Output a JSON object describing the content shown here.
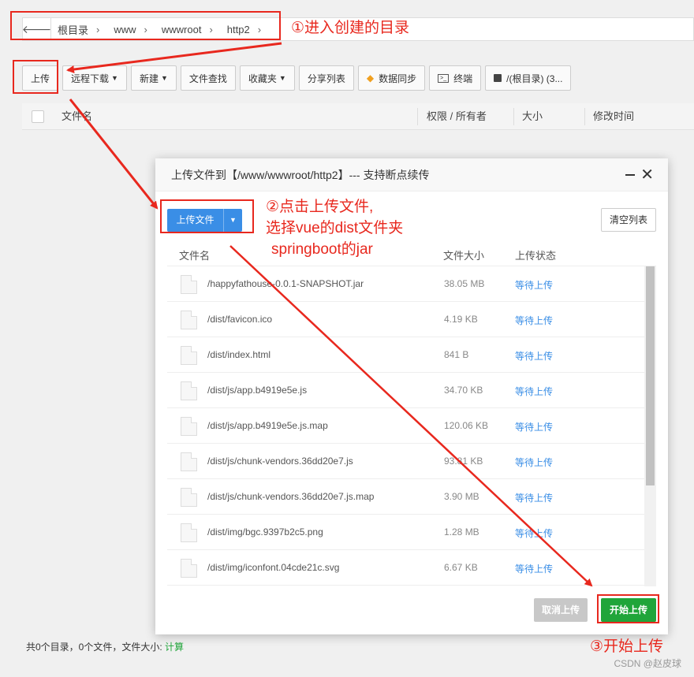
{
  "breadcrumb": [
    "根目录",
    "www",
    "wwwroot",
    "http2"
  ],
  "toolbar": {
    "upload": "上传",
    "remote_download": "远程下载",
    "new": "新建",
    "find": "文件查找",
    "favorites": "收藏夹",
    "share_list": "分享列表",
    "sync": "数据同步",
    "terminal": "终端",
    "disk": "/(根目录) (3..."
  },
  "table_header": {
    "name": "文件名",
    "perm": "权限 / 所有者",
    "size": "大小",
    "mtime": "修改时间"
  },
  "footer": {
    "summary": "共0个目录，0个文件，文件大小:",
    "calc": "计算"
  },
  "dialog": {
    "title": "上传文件到【/www/wwwroot/http2】--- 支持断点续传",
    "upload_btn": "上传文件",
    "clear_btn": "清空列表",
    "col_name": "文件名",
    "col_size": "文件大小",
    "col_status": "上传状态",
    "files": [
      {
        "name": "/happyfathouse-0.0.1-SNAPSHOT.jar",
        "size": "38.05 MB",
        "status": "等待上传"
      },
      {
        "name": "/dist/favicon.ico",
        "size": "4.19 KB",
        "status": "等待上传"
      },
      {
        "name": "/dist/index.html",
        "size": "841 B",
        "status": "等待上传"
      },
      {
        "name": "/dist/js/app.b4919e5e.js",
        "size": "34.70 KB",
        "status": "等待上传"
      },
      {
        "name": "/dist/js/app.b4919e5e.js.map",
        "size": "120.06 KB",
        "status": "等待上传"
      },
      {
        "name": "/dist/js/chunk-vendors.36dd20e7.js",
        "size": "93.81 KB",
        "status": "等待上传"
      },
      {
        "name": "/dist/js/chunk-vendors.36dd20e7.js.map",
        "size": "3.90 MB",
        "status": "等待上传"
      },
      {
        "name": "/dist/img/bgc.9397b2c5.png",
        "size": "1.28 MB",
        "status": "等待上传"
      },
      {
        "name": "/dist/img/iconfont.04cde21c.svg",
        "size": "6.67 KB",
        "status": "等待上传"
      }
    ],
    "cancel_btn": "取消上传",
    "start_btn": "开始上传"
  },
  "annotations": {
    "step1": "①进入创建的目录",
    "step2_line1": "②点击上传文件,",
    "step2_line2": "选择vue的dist文件夹",
    "step2_line3": "springboot的jar",
    "step3": "③开始上传"
  },
  "watermark": "CSDN @赵皮球",
  "colors": {
    "accent_blue": "#3a8ee6",
    "success_green": "#20a53a",
    "annotation_red": "#e8281e"
  }
}
